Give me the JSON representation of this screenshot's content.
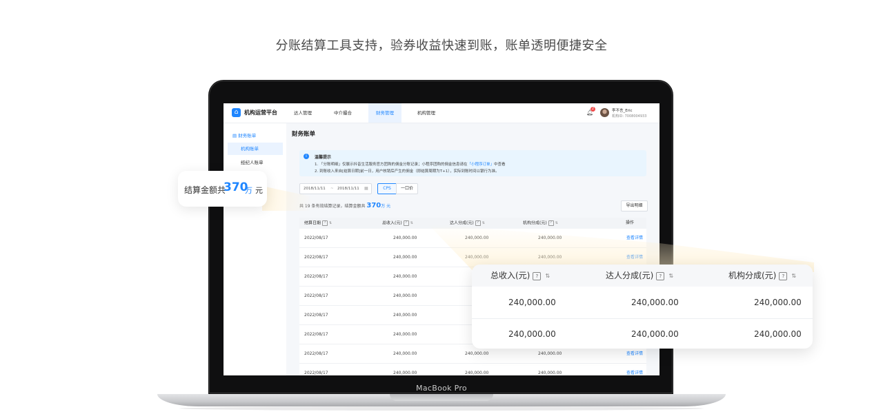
{
  "headline": "分账结算工具支持，验券收益快速到账，账单透明便捷安全",
  "device_label": "MacBook Pro",
  "app": {
    "title": "机构运营平台",
    "nav": [
      "达人管理",
      "中介撮合",
      "财务管理",
      "机构管理"
    ],
    "active_nav": "财务管理",
    "notification_count": "2",
    "user_name": "李不言_Eric",
    "user_id": "机构ID: 7008004933"
  },
  "sidebar": {
    "group": "财务账单",
    "items": [
      "机构账单",
      "经纪人账单"
    ]
  },
  "page": {
    "title": "财务账单",
    "tip": {
      "title": "温馨提示",
      "line1_a": "1. 「分账明细」仅展示抖音生活服务官方团购的佣金分账记录；小程序团购的佣金信息请在",
      "line1_link": "「小程序订单」",
      "line1_b": "中查看",
      "line2": "2. 到账收入来自[结算日期]前一日，用户核销后产生的佣金（即结算周期为T+1），实际到账时间以银行为准。"
    },
    "date_start": "2018/11/11",
    "date_sep": "~",
    "date_end": "2018/11/11",
    "segments": [
      "CPS",
      "一口价"
    ],
    "summary_prefix": "共 19 条有效结算记录，结算金额共",
    "summary_amount": "370",
    "summary_unit": "万 元",
    "export_label": "导出明细"
  },
  "table": {
    "columns": [
      "结算日期",
      "总收入(元)",
      "达人分成(元)",
      "机构分成(元)",
      "操作"
    ],
    "rows": [
      {
        "date": "2022/08/17",
        "total": "240,000.00",
        "talent": "240,000.00",
        "org": "240,000.00",
        "op": "查看详情"
      },
      {
        "date": "2022/08/17",
        "total": "240,000.00",
        "talent": "240,000.00",
        "org": "240,000.00",
        "op": "查看详情"
      },
      {
        "date": "2022/08/17",
        "total": "240,000.00",
        "talent": "",
        "org": "",
        "op": ""
      },
      {
        "date": "2022/08/17",
        "total": "240,000.00",
        "talent": "",
        "org": "",
        "op": ""
      },
      {
        "date": "2022/08/17",
        "total": "240,000.00",
        "talent": "",
        "org": "",
        "op": ""
      },
      {
        "date": "2022/08/17",
        "total": "240,000.00",
        "talent": "",
        "org": "",
        "op": ""
      },
      {
        "date": "2022/08/17",
        "total": "240,000.00",
        "talent": "240,000.00",
        "org": "240,000.00",
        "op": "查看详情"
      },
      {
        "date": "2022/08/17",
        "total": "240,000.00",
        "talent": "240,000.00",
        "org": "240,000.00",
        "op": "查看详情"
      }
    ]
  },
  "callout_left": {
    "label": "结算金额共",
    "amount": "370",
    "unit1": "万",
    "unit2": "元"
  },
  "callout_right": {
    "columns": [
      "总收入(元)",
      "达人分成(元)",
      "机构分成(元)"
    ],
    "rows": [
      [
        "240,000.00",
        "240,000.00",
        "240,000.00"
      ],
      [
        "240,000.00",
        "240,000.00",
        "240,000.00"
      ]
    ]
  },
  "colors": {
    "accent": "#1f86ff",
    "tip_bg": "#e9f5fe",
    "badge": "#f04d4d"
  },
  "icons": {
    "logo": "home-icon",
    "bell": "bell-icon",
    "info": "info-icon",
    "calendar": "calendar-icon",
    "help": "question-icon",
    "sort": "sort-icon",
    "sidebar": "clipboard-icon"
  }
}
